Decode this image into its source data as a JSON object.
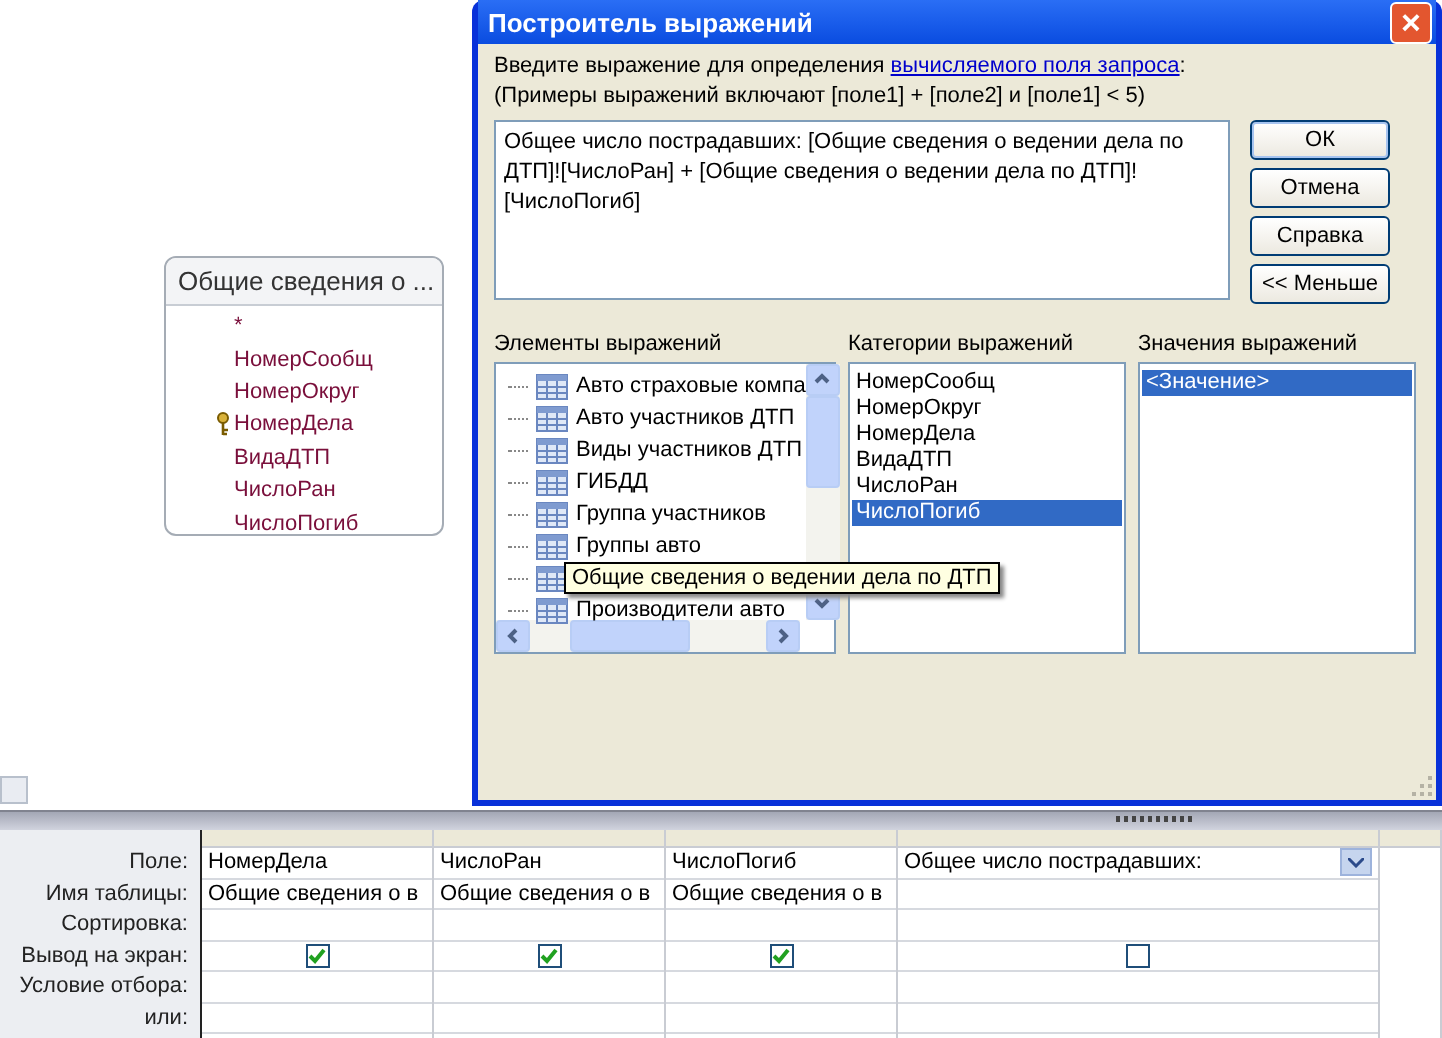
{
  "table_box": {
    "title": "Общие сведения о ...",
    "fields": [
      {
        "label": "*",
        "primary_key": false
      },
      {
        "label": "НомерСообщ",
        "primary_key": false
      },
      {
        "label": "НомерОкруг",
        "primary_key": false
      },
      {
        "label": "НомерДела",
        "primary_key": true
      },
      {
        "label": "ВидаДТП",
        "primary_key": false
      },
      {
        "label": "ЧислоРан",
        "primary_key": false
      },
      {
        "label": "ЧислоПогиб",
        "primary_key": false
      }
    ]
  },
  "dialog": {
    "title": "Построитель выражений",
    "close": "×",
    "prompt_prefix": "Введите выражение для определения ",
    "prompt_link": "вычисляемого поля запроса",
    "prompt_suffix": ":",
    "example": "(Примеры выражений включают [поле1] + [поле2] и [поле1] < 5)",
    "expression": "Общее число пострадавших:  [Общие сведения о ведении дела по ДТП]![ЧислоРан] + [Общие сведения о ведении дела по ДТП]![ЧислоПогиб]",
    "buttons": [
      {
        "label": "ОК",
        "default": true
      },
      {
        "label": "Отмена",
        "default": false
      },
      {
        "label": "Справка",
        "default": false
      },
      {
        "label": "<< Меньше",
        "default": false
      }
    ],
    "elements": {
      "label": "Элементы выражений",
      "items": [
        {
          "label": "Авто страховые компа",
          "hovered": false
        },
        {
          "label": "Авто участников ДТП",
          "hovered": false
        },
        {
          "label": "Виды участников ДТП",
          "hovered": false
        },
        {
          "label": "ГИБДД",
          "hovered": false
        },
        {
          "label": "Группа участников",
          "hovered": false
        },
        {
          "label": "Группы авто",
          "hovered": false
        },
        {
          "label": "Общие сведения о ведении дела по ДТП",
          "hovered": true
        },
        {
          "label": "Производители авто",
          "hovered": false
        }
      ]
    },
    "categories": {
      "label": "Категории выражений",
      "items": [
        {
          "label": "НомерСообщ",
          "selected": false
        },
        {
          "label": "НомерОкруг",
          "selected": false
        },
        {
          "label": "НомерДела",
          "selected": false
        },
        {
          "label": "ВидаДТП",
          "selected": false
        },
        {
          "label": "ЧислоРан",
          "selected": false
        },
        {
          "label": "ЧислоПогиб",
          "selected": true
        }
      ]
    },
    "values": {
      "label": "Значения выражений",
      "items": [
        {
          "label": "<Значение>",
          "selected": true
        }
      ]
    }
  },
  "grid": {
    "row_labels": [
      "Поле:",
      "Имя таблицы:",
      "Сортировка:",
      "Вывод на экран:",
      "Условие отбора:",
      "или:"
    ],
    "columns": [
      {
        "field": "НомерДела",
        "table": "Общие сведения о в",
        "show": true,
        "dropdown": false
      },
      {
        "field": "ЧислоРан",
        "table": "Общие сведения о в",
        "show": true,
        "dropdown": false
      },
      {
        "field": "ЧислоПогиб",
        "table": "Общие сведения о в",
        "show": true,
        "dropdown": false
      },
      {
        "field": "Общее число пострадавших:",
        "show": false,
        "dropdown": true
      }
    ]
  }
}
